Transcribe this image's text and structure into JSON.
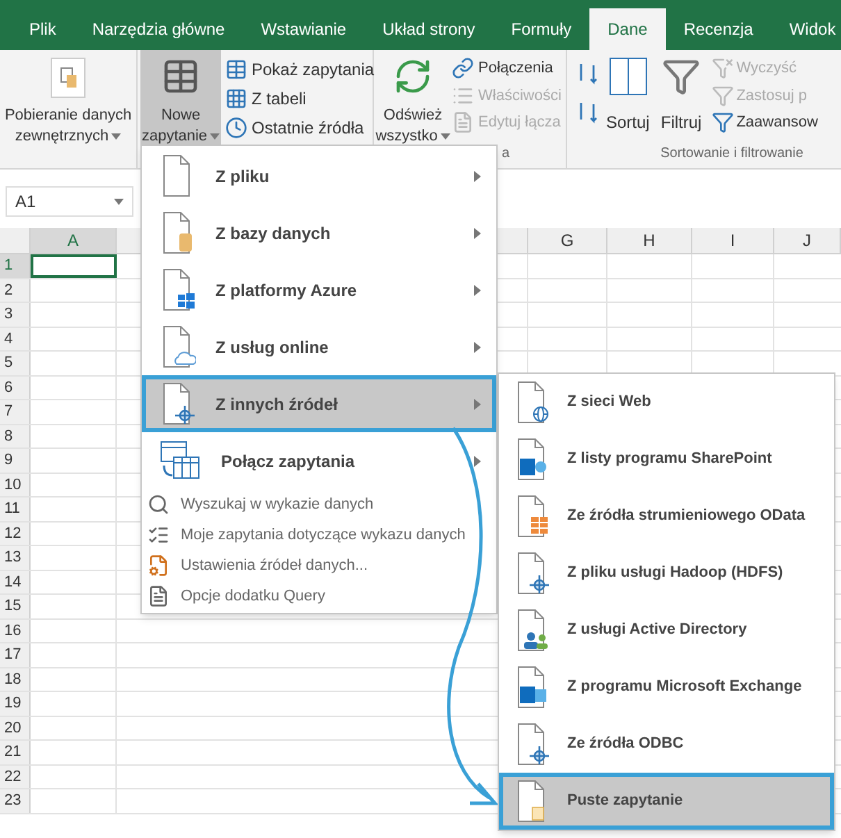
{
  "tabs": [
    {
      "label": "Plik",
      "selected": false
    },
    {
      "label": "Narzędzia główne",
      "selected": false
    },
    {
      "label": "Wstawianie",
      "selected": false
    },
    {
      "label": "Układ strony",
      "selected": false
    },
    {
      "label": "Formuły",
      "selected": false
    },
    {
      "label": "Dane",
      "selected": true
    },
    {
      "label": "Recenzja",
      "selected": false
    },
    {
      "label": "Widok",
      "selected": false
    }
  ],
  "ribbon": {
    "get_external": {
      "line1": "Pobieranie danych",
      "line2": "zewnętrznych"
    },
    "new_query": {
      "line1": "Nowe",
      "line2": "zapytanie",
      "pressed": true
    },
    "query_buttons": [
      {
        "label": "Pokaż zapytania"
      },
      {
        "label": "Z tabeli"
      },
      {
        "label": "Ostatnie źródła"
      }
    ],
    "refresh": {
      "line1": "Odśwież",
      "line2": "wszystko"
    },
    "connection_buttons": [
      {
        "label": "Połączenia",
        "disabled": false
      },
      {
        "label": "Właściwości",
        "disabled": true
      },
      {
        "label": "Edytuj łącza",
        "disabled": true
      }
    ],
    "connections_group_label": "a",
    "sort": {
      "label": "Sortuj"
    },
    "filter": {
      "label": "Filtruj"
    },
    "filter_buttons": [
      {
        "label": "Wyczyść",
        "disabled": true
      },
      {
        "label": "Zastosuj p",
        "disabled": true
      },
      {
        "label": "Zaawansow",
        "disabled": false
      }
    ],
    "sort_group_label": "Sortowanie i filtrowanie"
  },
  "name_box": "A1",
  "columns": [
    {
      "label": "A",
      "selected": true
    },
    {
      "label": "G",
      "selected": false
    },
    {
      "label": "H",
      "selected": false
    },
    {
      "label": "I",
      "selected": false
    },
    {
      "label": "J",
      "selected": false
    }
  ],
  "rows": [
    {
      "label": "1",
      "selected": true
    },
    {
      "label": "2",
      "selected": false
    },
    {
      "label": "3",
      "selected": false
    },
    {
      "label": "4",
      "selected": false
    },
    {
      "label": "5",
      "selected": false
    },
    {
      "label": "6",
      "selected": false
    },
    {
      "label": "7",
      "selected": false
    },
    {
      "label": "8",
      "selected": false
    },
    {
      "label": "9",
      "selected": false
    },
    {
      "label": "10",
      "selected": false
    },
    {
      "label": "11",
      "selected": false
    },
    {
      "label": "12",
      "selected": false
    },
    {
      "label": "13",
      "selected": false
    },
    {
      "label": "14",
      "selected": false
    },
    {
      "label": "15",
      "selected": false
    },
    {
      "label": "16",
      "selected": false
    },
    {
      "label": "17",
      "selected": false
    },
    {
      "label": "18",
      "selected": false
    },
    {
      "label": "19",
      "selected": false
    },
    {
      "label": "20",
      "selected": false
    },
    {
      "label": "21",
      "selected": false
    },
    {
      "label": "22",
      "selected": false
    },
    {
      "label": "23",
      "selected": false
    }
  ],
  "menu": [
    {
      "label": "Z pliku",
      "kind": "large",
      "selected": false
    },
    {
      "label": "Z bazy danych",
      "kind": "large",
      "selected": false
    },
    {
      "label": "Z platformy Azure",
      "kind": "large",
      "selected": false
    },
    {
      "label": "Z usług online",
      "kind": "large",
      "selected": false
    },
    {
      "label": "Z innych źródeł",
      "kind": "large",
      "selected": true
    },
    {
      "label": "Połącz zapytania",
      "kind": "large",
      "selected": false
    },
    {
      "label": "Wyszukaj w wykazie danych",
      "kind": "small",
      "selected": false
    },
    {
      "label": "Moje zapytania dotyczące wykazu danych",
      "kind": "small",
      "selected": false
    },
    {
      "label": "Ustawienia źródeł danych...",
      "kind": "small",
      "selected": false
    },
    {
      "label": "Opcje dodatku Query",
      "kind": "small",
      "selected": false
    }
  ],
  "submenu": [
    {
      "label": "Z sieci Web",
      "selected": false
    },
    {
      "label": "Z listy programu SharePoint",
      "selected": false
    },
    {
      "label": "Ze źródła strumieniowego OData",
      "selected": false
    },
    {
      "label": "Z pliku usługi Hadoop (HDFS)",
      "selected": false
    },
    {
      "label": "Z usługi Active Directory",
      "selected": false
    },
    {
      "label": "Z programu Microsoft Exchange",
      "selected": false
    },
    {
      "label": "Ze źródła ODBC",
      "selected": false
    },
    {
      "label": "Puste zapytanie",
      "selected": true
    }
  ]
}
